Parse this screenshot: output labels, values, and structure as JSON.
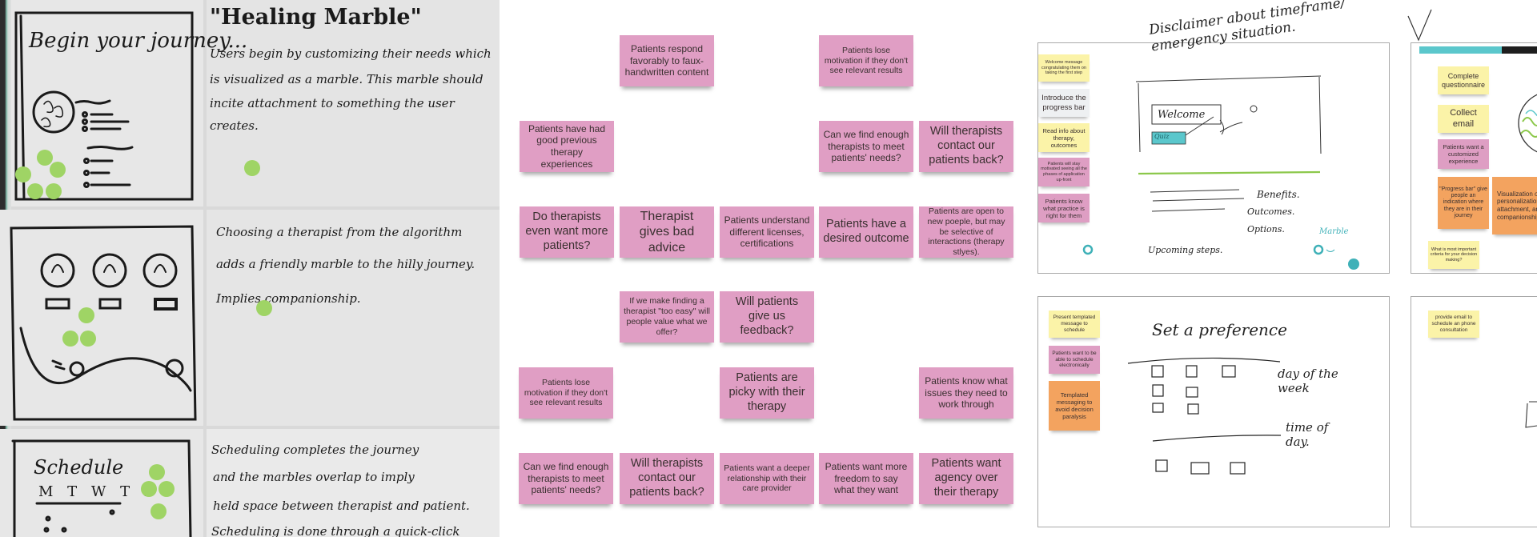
{
  "photo": {
    "panels": [
      {
        "sketch_title": "Begin your journey...",
        "title": "\"Healing Marble\"",
        "lines": [
          "Users begin by customizing their needs which",
          "is visualized as a marble. This marble should",
          "incite attachment to something the user",
          "creates."
        ]
      },
      {
        "sketch_title": "",
        "lines": [
          "Choosing a therapist from the algorithm",
          "adds a friendly marble to the hilly journey.",
          "Implies companionship."
        ]
      },
      {
        "sketch_title": "Schedule",
        "sketch_days": "M T W T F",
        "lines": [
          "Scheduling completes the journey",
          "and the marbles overlap to imply",
          "held space between therapist and patient.",
          "Scheduling is done through a quick-click"
        ]
      }
    ],
    "marble_color": "#9fd465"
  },
  "board": {
    "sticky_color": "#e09ec4",
    "notes": [
      "Patients respond favorably to faux-handwritten content",
      "Patients lose motivation if they don't see relevant results",
      "Patients have had good previous therapy experiences",
      "Can we find enough therapists to meet patients' needs?",
      "Will therapists contact our patients back?",
      "Do therapists even want more patients?",
      "Therapist gives bad advice",
      "Patients understand different licenses, certifications",
      "Patients have a desired outcome",
      "Patients are open to new poeple, but may be selective of interactions (therapy stlyes).",
      "If we make finding a therapist \"too easy\" will people value what we offer?",
      "Will patients give us feedback?",
      "Patients lose motivation if they don't see relevant results",
      "Patients are picky with their therapy",
      "Patients know what issues they need to work through",
      "Can we find enough therapists to meet patients' needs?",
      "Will therapists contact our patients back?",
      "Patients want a deeper relationship with their care provider",
      "Patients want more freedom to say what they want",
      "Patients want agency over their therapy"
    ]
  },
  "wireframes": {
    "frame1": {
      "heading": "Disclaimer about timeframe/ emergency situation.",
      "welcome": "Welcome",
      "quiz": "Quiz",
      "list": [
        "Benefits.",
        "Outcomes.",
        "Options."
      ],
      "footer": "Upcoming steps.",
      "marble_label": "Marble",
      "notes": [
        {
          "text": "Welcome message congratulating them on taking the first step",
          "color": "yellow"
        },
        {
          "text": "Introduce the progress bar",
          "color": "grey"
        },
        {
          "text": "Read info about therapy, outcomes",
          "color": "yellow"
        },
        {
          "text": "Patients will stay motivated seeing all the phases of application up-front",
          "color": "pink"
        },
        {
          "text": "Patients know what practice is right for them",
          "color": "pink"
        }
      ]
    },
    "frame2": {
      "heading": "Set a preference",
      "label_days": "day of the week",
      "label_time": "time of day.",
      "notes": [
        {
          "text": "Present templated message to schedule",
          "color": "yellow"
        },
        {
          "text": "Patients want to be able to schedule electronically",
          "color": "pink"
        },
        {
          "text": "Templated messaging to avoid decision paralysis",
          "color": "orange"
        }
      ]
    },
    "frame3": {
      "notes": [
        {
          "text": "Complete questionnaire",
          "color": "yellow"
        },
        {
          "text": "Collect email",
          "color": "yellow"
        },
        {
          "text": "Patients want a customized experience",
          "color": "pink"
        },
        {
          "text": "\"Progress bar\" give people an indication where they are in their journey",
          "color": "orange"
        },
        {
          "text": "Visualization of personalization, attachment, and companionship",
          "color": "orange"
        },
        {
          "text": "What is most important criteria for your decision making?",
          "color": "yellow"
        }
      ]
    },
    "frame4": {
      "notes": [
        {
          "text": "provide email to schedule an phone consultation",
          "color": "yellow"
        }
      ]
    },
    "accent_colors": {
      "teal": "#5bc7cc",
      "green_line": "#8cc84b",
      "progress_dark": "#1e1e1e"
    }
  }
}
